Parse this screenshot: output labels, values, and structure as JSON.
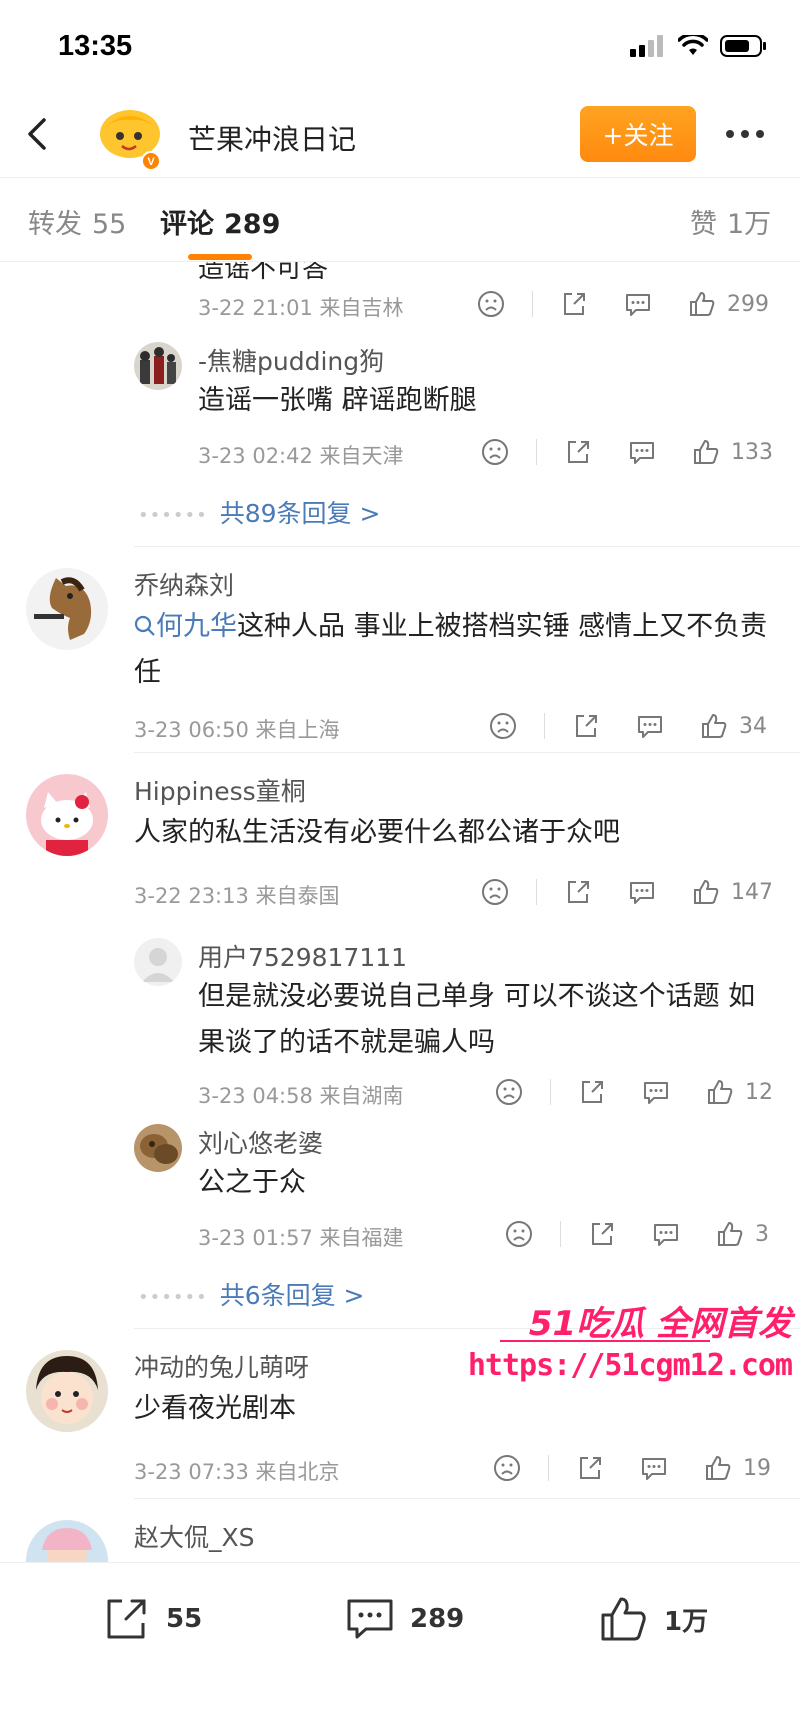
{
  "status_bar": {
    "time": "13:35"
  },
  "nav": {
    "account_name": "芒果冲浪日记",
    "follow_label": "+关注"
  },
  "tabs": {
    "repost_label": "转发",
    "repost_count": "55",
    "comment_label": "评论",
    "comment_count": "289",
    "like_label": "赞",
    "like_count": "1万"
  },
  "feed": {
    "cut_off_text": "造谣不可答",
    "comments": [
      {
        "id": "c0",
        "meta": "3-22 21:01 来自吉林",
        "likes": "299"
      },
      {
        "id": "c0r1",
        "name": "-焦糖pudding狗",
        "text": "造谣一张嘴 辟谣跑断腿",
        "meta": "3-23 02:42 来自天津",
        "likes": "133"
      },
      {
        "id": "c0more",
        "more_replies": "共89条回复 >"
      },
      {
        "id": "c1",
        "name": "乔纳森刘",
        "topic": "何九华",
        "text": "这种人品 事业上被搭档实锤 感情上又不负责任",
        "meta": "3-23 06:50 来自上海",
        "likes": "34"
      },
      {
        "id": "c2",
        "name": "Hippiness童桐",
        "text": "人家的私生活没有必要什么都公诸于众吧",
        "meta": "3-22 23:13 来自泰国",
        "likes": "147"
      },
      {
        "id": "c2r1",
        "name": "用户7529817111",
        "text": "但是就没必要说自己单身 可以不谈这个话题 如果谈了的话不就是骗人吗",
        "meta": "3-23 04:58 来自湖南",
        "likes": "12"
      },
      {
        "id": "c2r2",
        "name": "刘心悠老婆",
        "text": "公之于众",
        "meta": "3-23 01:57 来自福建",
        "likes": "3"
      },
      {
        "id": "c2more",
        "more_replies": "共6条回复 >"
      },
      {
        "id": "c3",
        "name": "冲动的兔儿萌呀",
        "text": "少看夜光剧本",
        "meta": "3-23 07:33 来自北京",
        "likes": "19"
      },
      {
        "id": "c4",
        "name": "赵大侃_XS"
      }
    ]
  },
  "watermark": {
    "brand": "51吃瓜 全网首发",
    "url": "https://51cgm12.com"
  },
  "bottom_bar": {
    "repost_count": "55",
    "comment_count": "289",
    "like_count": "1万"
  },
  "colors": {
    "accent_orange": "#ff8200",
    "link_blue": "#4a7bb8",
    "watermark_pink": "#ff1f6a"
  }
}
